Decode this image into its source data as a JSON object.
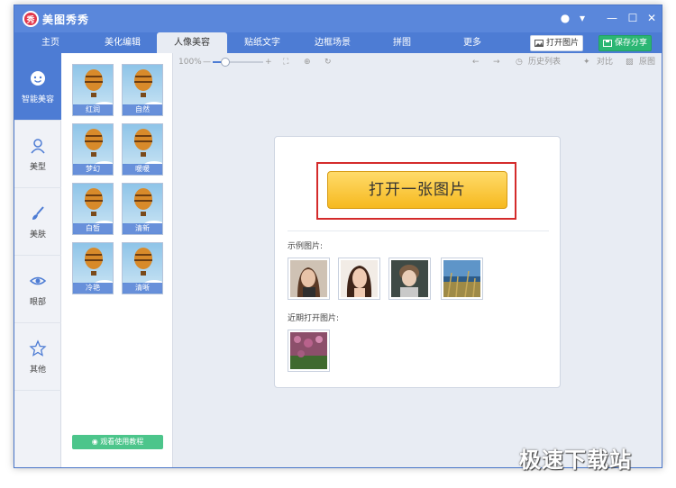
{
  "app": {
    "logo_char": "秀",
    "title": "美图秀秀"
  },
  "title_controls": {
    "skin": "●",
    "menu": "▾",
    "minimize": "—",
    "maximize": "☐",
    "close": "✕"
  },
  "nav": {
    "tabs": [
      "主页",
      "美化编辑",
      "人像美容",
      "贴纸文字",
      "边框场景",
      "拼图",
      "更多"
    ],
    "active_tab": "人像美容",
    "open_image": "打开图片",
    "save_share": "保存分享"
  },
  "sidebar": {
    "items": [
      {
        "label": "智能美容",
        "icon": "face-smile-icon",
        "active": true
      },
      {
        "label": "美型",
        "icon": "person-icon",
        "active": false
      },
      {
        "label": "美肤",
        "icon": "brush-icon",
        "active": false
      },
      {
        "label": "眼部",
        "icon": "eye-icon",
        "active": false
      },
      {
        "label": "其他",
        "icon": "star-icon",
        "active": false
      }
    ]
  },
  "effects": {
    "thumbs": [
      "红润",
      "自然",
      "梦幻",
      "暖暖",
      "白皙",
      "清新",
      "冷艳",
      "清晰"
    ],
    "tutorial": "观看使用教程"
  },
  "toolbar": {
    "zoom": "100%",
    "zoom_level": 0.25,
    "history": "历史列表",
    "compare": "对比",
    "original": "原图"
  },
  "panel": {
    "open_button": "打开一张图片",
    "samples_label": "示例图片:",
    "recent_label": "近期打开图片:"
  },
  "watermark": "极速下载站",
  "colors": {
    "titlebar": "#5a87db",
    "nav": "#4d7cd4",
    "accent_green": "#2bb673",
    "open_button": "#f6b91f",
    "highlight_frame": "#d42b2b"
  }
}
